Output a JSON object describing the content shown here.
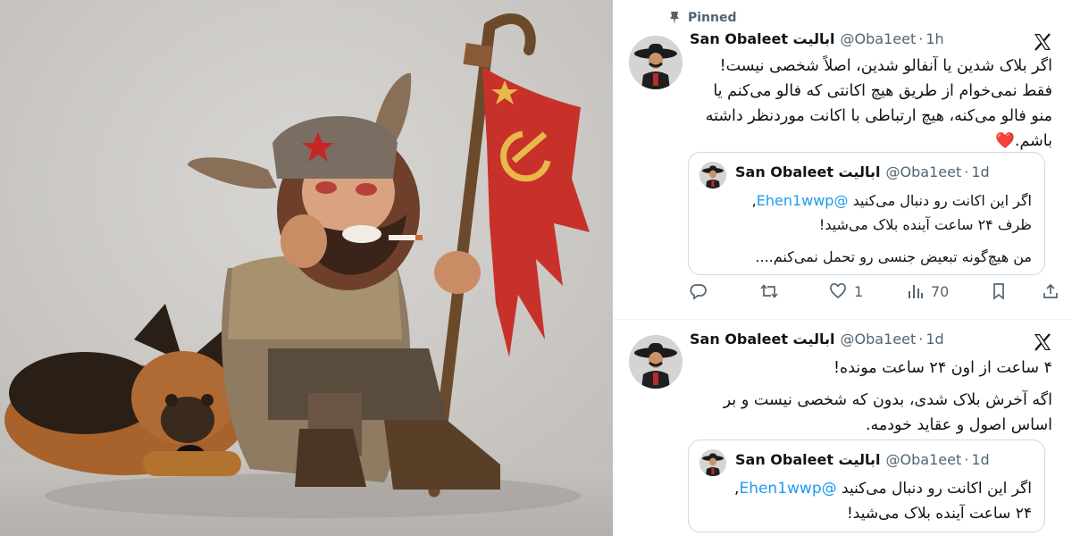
{
  "tweet1": {
    "pinned_label": "Pinned",
    "name": "San Obaleet ابالیت",
    "handle": "@Oba1eet",
    "time": "1h",
    "lines": [
      "اگر بلاک شدین یا آنفالو شدین، اصلاً شخصی نیست!",
      "فقط نمی‌خوام از طریق هیچ اکانتی که فالو می‌کنم یا",
      "منو فالو می‌کنه، هیچ ارتباطی با اکانت موردنظر داشته",
      "باشم.",
      "❤️"
    ],
    "quote": {
      "name": "San Obaleet ابالیت",
      "handle": "@Oba1eet",
      "time": "1d",
      "line1_text": "اگر این اکانت رو دنبال می‌کنید",
      "line1_mention": "@Ehen1wwp",
      "line1_end": ",",
      "line2": "ظرف ۲۴ ساعت آینده بلاک می‌شید!",
      "line3": "من هیچ‌گونه تبعیض جنسی رو تحمل نمی‌کنم...."
    },
    "actions": {
      "likes": "1",
      "views": "70"
    }
  },
  "tweet2": {
    "name": "San Obaleet ابالیت",
    "handle": "@Oba1eet",
    "time": "1d",
    "line1": "۴ ساعت از اون ۲۴ ساعت مونده!",
    "line2": "اگه آخرش بلاک شدی، بدون که شخصی نیست و بر",
    "line3": "اساس اصول و عقاید خودمه.",
    "quote": {
      "name": "San Obaleet ابالیت",
      "handle": "@Oba1eet",
      "time": "1d",
      "line1_text": "اگر این اکانت رو دنبال می‌کنید",
      "line1_mention": "@Ehen1wwp",
      "line1_end": ",",
      "line2": "۲۴ ساعت آینده بلاک می‌شید!"
    }
  },
  "colors": {
    "accent": "#1d9bf0",
    "secondary_text": "#536471",
    "border": "#cfd9de"
  },
  "icons": [
    "pin-icon",
    "x-logo-icon",
    "reply-icon",
    "retweet-icon",
    "like-icon",
    "views-icon",
    "bookmark-icon",
    "share-icon"
  ]
}
